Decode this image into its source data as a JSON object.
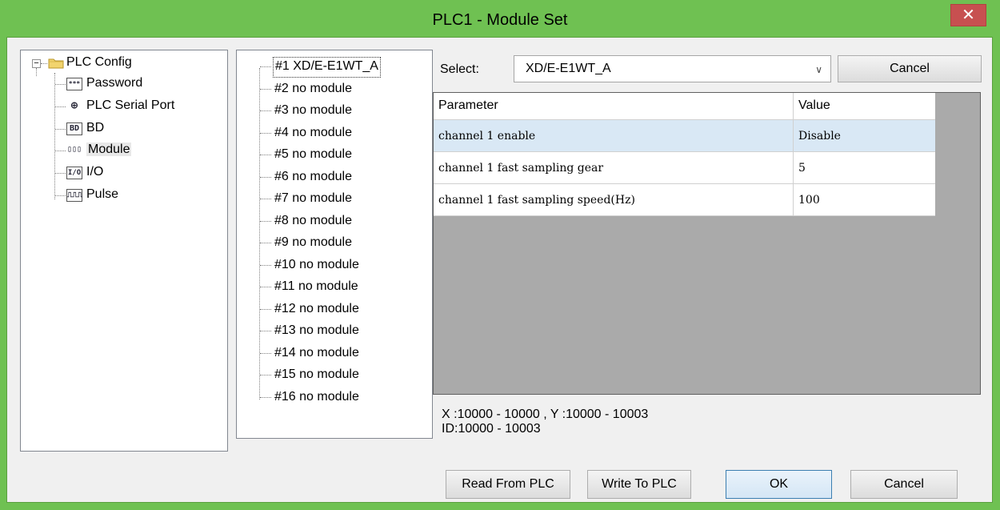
{
  "window": {
    "title": "PLC1 - Module  Set",
    "close_glyph": "✕"
  },
  "tree": {
    "root_label": "PLC Config",
    "expander_glyph": "−",
    "items": [
      {
        "label": "Password",
        "icon": "password-icon",
        "glyph": "***"
      },
      {
        "label": "PLC Serial Port",
        "icon": "serial-port-icon",
        "glyph": "⊕"
      },
      {
        "label": "BD",
        "icon": "bd-icon",
        "glyph": "BD"
      },
      {
        "label": "Module",
        "icon": "module-icon",
        "glyph": "▯▯▯"
      },
      {
        "label": "I/O",
        "icon": "io-icon",
        "glyph": "I/O"
      },
      {
        "label": "Pulse",
        "icon": "pulse-icon",
        "glyph": "⎍⎍⎍"
      }
    ],
    "selected": "Module"
  },
  "modules": [
    "#1 XD/E-E1WT_A",
    "#2 no module",
    "#3 no module",
    "#4 no module",
    "#5 no module",
    "#6 no module",
    "#7 no module",
    "#8 no module",
    "#9 no module",
    "#10 no module",
    "#11 no module",
    "#12 no module",
    "#13 no module",
    "#14 no module",
    "#15 no module",
    "#16 no module"
  ],
  "select": {
    "label": "Select:",
    "value": "XD/E-E1WT_A",
    "arrow_glyph": "∨",
    "cancel_label": "Cancel"
  },
  "grid": {
    "headers": [
      "Parameter",
      "Value"
    ],
    "rows": [
      {
        "parameter": "channel 1 enable",
        "value": "Disable"
      },
      {
        "parameter": "channel 1 fast sampling gear",
        "value": "5"
      },
      {
        "parameter": "channel 1 fast sampling speed(Hz)",
        "value": "100"
      }
    ]
  },
  "address": {
    "line1": "X :10000 - 10000 , Y :10000 - 10003",
    "line2": "ID:10000 - 10003"
  },
  "buttons": {
    "read": "Read From PLC",
    "write": "Write To PLC",
    "ok": "OK",
    "cancel": "Cancel"
  },
  "colors": {
    "frame": "#6fc152",
    "close": "#c75050",
    "selected_row": "#d9e8f5",
    "grid_bg": "#aaaaaa"
  }
}
